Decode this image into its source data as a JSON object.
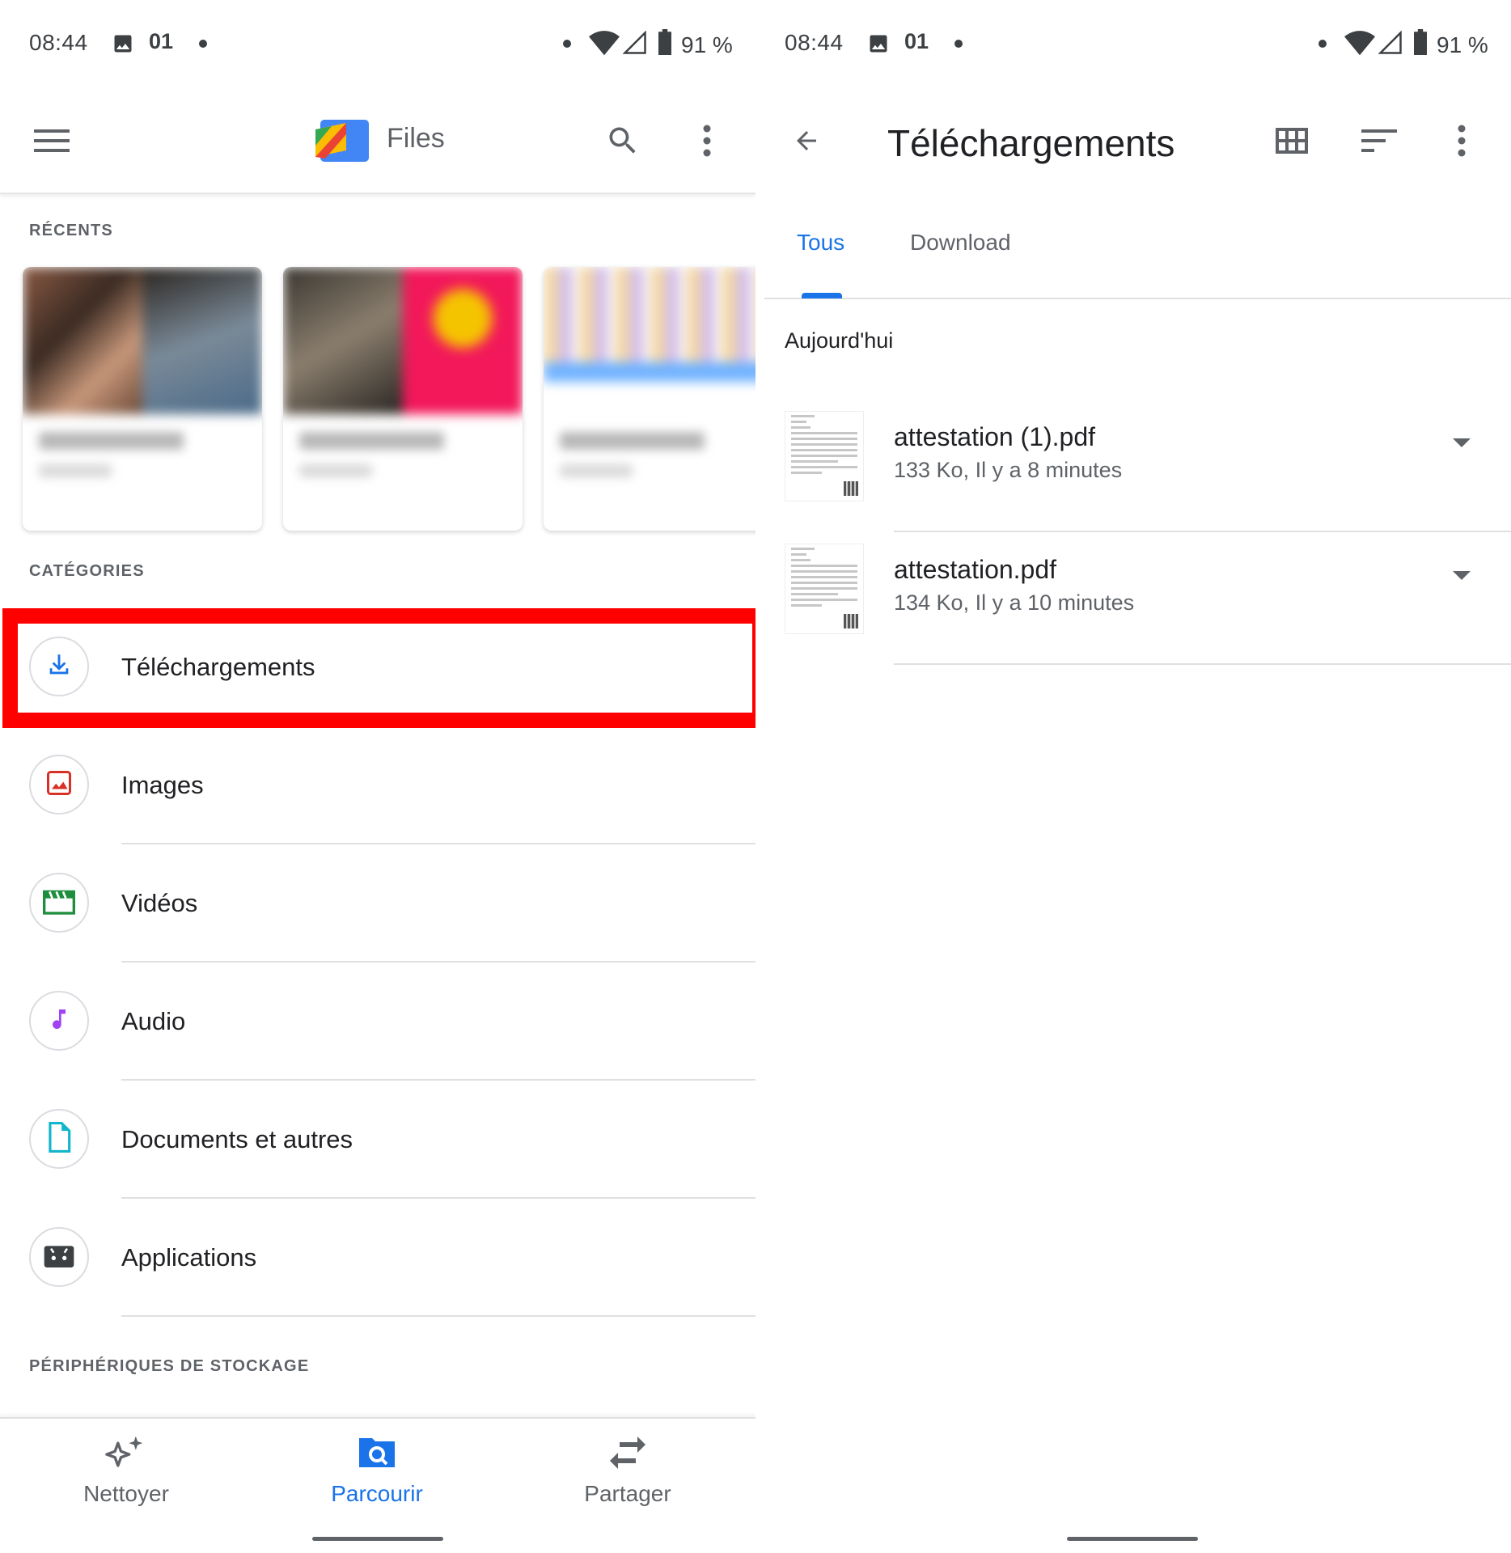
{
  "status_bar": {
    "time": "08:44",
    "carrier_badge": "01",
    "battery_percent": "91 %",
    "icons": [
      "image-icon",
      "wifi-icon",
      "signal-icon",
      "battery-icon"
    ]
  },
  "left_screen": {
    "header": {
      "app_title": "Files",
      "icons": [
        "menu-icon",
        "files-logo-icon",
        "search-icon",
        "more-vert-icon"
      ]
    },
    "recents_label": "RÉCENTS",
    "categories_label": "CATÉGORIES",
    "categories": [
      {
        "label": "Téléchargements",
        "icon": "download-icon",
        "color": "#1a73e8",
        "highlighted": true
      },
      {
        "label": "Images",
        "icon": "image-icon",
        "color": "#d93025"
      },
      {
        "label": "Vidéos",
        "icon": "movie-icon",
        "color": "#1e8e3e"
      },
      {
        "label": "Audio",
        "icon": "music-note-icon",
        "color": "#a142f4"
      },
      {
        "label": "Documents et autres",
        "icon": "document-icon",
        "color": "#12b5cb"
      },
      {
        "label": "Applications",
        "icon": "android-icon",
        "color": "#3c4043"
      }
    ],
    "storage_label": "PÉRIPHÉRIQUES DE STOCKAGE",
    "bottom_nav": [
      {
        "label": "Nettoyer",
        "icon": "sparkle-icon",
        "active": false
      },
      {
        "label": "Parcourir",
        "icon": "browse-icon",
        "active": true
      },
      {
        "label": "Partager",
        "icon": "swap-icon",
        "active": false
      }
    ],
    "accent_color": "#1a73e8",
    "highlight_color": "#ff0000"
  },
  "right_screen": {
    "header": {
      "title": "Téléchargements",
      "icons": [
        "back-arrow-icon",
        "grid-view-icon",
        "sort-icon",
        "more-vert-icon"
      ]
    },
    "tabs": [
      {
        "label": "Tous",
        "active": true
      },
      {
        "label": "Download",
        "active": false
      }
    ],
    "group_title": "Aujourd'hui",
    "files": [
      {
        "name": "attestation (1).pdf",
        "meta": "133 Ko, Il y a 8 minutes"
      },
      {
        "name": "attestation.pdf",
        "meta": "134 Ko, Il y a 10 minutes"
      }
    ]
  }
}
